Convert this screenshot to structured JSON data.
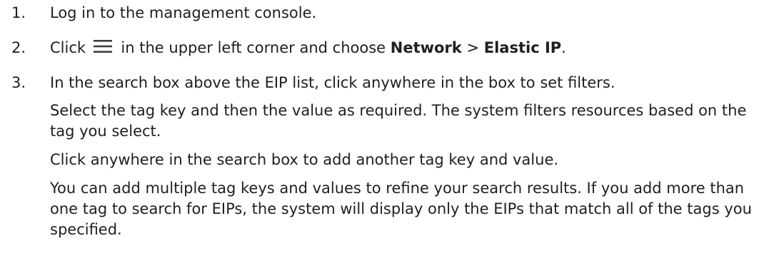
{
  "steps": [
    {
      "number": "1.",
      "text": "Log in to the management console."
    },
    {
      "number": "2.",
      "prefix": "Click",
      "icon": "hamburger-menu-icon",
      "middle": "in the upper left corner and choose",
      "menu": "Network",
      "separator": ">",
      "submenu": "Elastic IP",
      "suffix": "."
    },
    {
      "number": "3.",
      "text": "In the search box above the EIP list, click anywhere in the box to set filters."
    }
  ],
  "paragraphs": [
    "Select the tag key and then the value as required. The system filters resources based on the tag you select.",
    "Click anywhere in the search box to add another tag key and value.",
    "You can add multiple tag keys and values to refine your search results. If you add more than one tag to search for EIPs, the system will display only the EIPs that match all of the tags you specified."
  ],
  "colors": {
    "text": "#1f1f1f",
    "icon": "#3d3d3d"
  }
}
